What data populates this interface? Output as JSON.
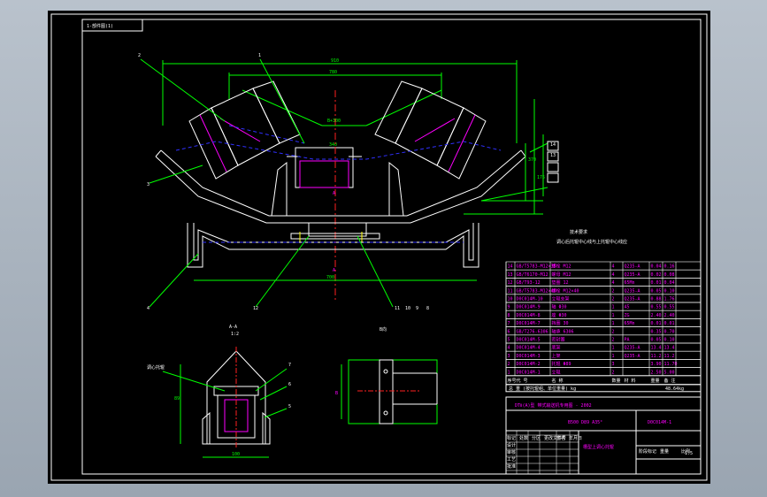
{
  "drawing": {
    "stamp": "1-部件图(1)",
    "title_main": "DTⅡ(A)型  带式输送机专用图 - 2002",
    "title_code": "B500 D89 A35°",
    "title_drawing_no": "D0C014M-1",
    "title_name": "槽型上调心托辊",
    "section_label_a": "A-A",
    "section_label_a_scale": "1:2",
    "section_label_b": "B向",
    "notes_heading": "技术要求",
    "notes_text": "调心后托辊中心线与上托辊中心线应",
    "total_weight": "48.64kg",
    "dim_top_overall": "910",
    "dim_inner": "780",
    "dim_mid": "B+300",
    "dim_center": "340",
    "dim_base": "1000",
    "dim_base_inner": "700",
    "dim_height_a": "370",
    "dim_height_b": "175",
    "dim_side": "25",
    "dim_label_a": "A",
    "dim_label_b": "B",
    "dim_detail_w": "100",
    "dim_detail_h": "89",
    "part_label": "调心托辊"
  },
  "balloons": [
    "2",
    "1",
    "3",
    "4",
    "12",
    "11",
    "10",
    "9",
    "8",
    "14",
    "13",
    "7",
    "6",
    "5"
  ],
  "parts_table": {
    "rows": [
      {
        "no": "14",
        "code": "GB/T5783-M12×35",
        "name": "螺栓 M12",
        "qty": "4",
        "mat": "Q235-A",
        "wt": "0.04",
        "total": "0.16"
      },
      {
        "no": "13",
        "code": "GB/T6170-M12",
        "name": "螺母 M12",
        "qty": "4",
        "mat": "Q235-A",
        "wt": "0.02",
        "total": "0.08"
      },
      {
        "no": "12",
        "code": "GB/T93-12",
        "name": "垫圈 12",
        "qty": "4",
        "mat": "65Mn",
        "wt": "0.01",
        "total": "0.04"
      },
      {
        "no": "11",
        "code": "GB/T5783-M12×40",
        "name": "螺栓 M12×40",
        "qty": "2",
        "mat": "Q235-A",
        "wt": "0.05",
        "total": "0.10"
      },
      {
        "no": "10",
        "code": "D0C014M-10",
        "name": "立辊支架",
        "qty": "2",
        "mat": "Q235-A",
        "wt": "0.88",
        "total": "1.76"
      },
      {
        "no": "9",
        "code": "D0C014M-9",
        "name": "轴 Φ30",
        "qty": "1",
        "mat": "45",
        "wt": "0.55",
        "total": "0.55"
      },
      {
        "no": "8",
        "code": "D0C014M-8",
        "name": "座 Φ30",
        "qty": "1",
        "mat": "ZG",
        "wt": "2.40",
        "total": "2.40"
      },
      {
        "no": "7",
        "code": "D0C014M-7",
        "name": "挡圈 30",
        "qty": "1",
        "mat": "65Mn",
        "wt": "0.01",
        "total": "0.01"
      },
      {
        "no": "6",
        "code": "GB/T276-6306",
        "name": "轴承 6306",
        "qty": "2",
        "mat": "",
        "wt": "0.35",
        "total": "0.70"
      },
      {
        "no": "5",
        "code": "D0C014M-5",
        "name": "密封圈",
        "qty": "2",
        "mat": "PA",
        "wt": "0.05",
        "total": "0.10"
      },
      {
        "no": "4",
        "code": "D0C014M-4",
        "name": "底架",
        "qty": "1",
        "mat": "Q235-A",
        "wt": "13.4",
        "total": "13.4"
      },
      {
        "no": "3",
        "code": "D0C014M-3",
        "name": "上架",
        "qty": "1",
        "mat": "Q235-A",
        "wt": "11.2",
        "total": "11.2"
      },
      {
        "no": "2",
        "code": "D0C014M-2",
        "name": "托辊 Φ89",
        "qty": "3",
        "mat": "",
        "wt": "3.90",
        "total": "11.70"
      },
      {
        "no": "1",
        "code": "D0C014M-1",
        "name": "立辊",
        "qty": "2",
        "mat": "",
        "wt": "2.50",
        "total": "5.00"
      }
    ],
    "header": {
      "no": "序号",
      "code": "代 号",
      "name": "名 称",
      "qty": "数量",
      "mat": "材 料",
      "weight": "重量",
      "note": "备 注"
    },
    "subheader": "总 重  (按托辊组、单位重量)  kg",
    "signoff": [
      "标记",
      "处数",
      "分区",
      "更改文件号",
      "签名",
      "年月日",
      "设计",
      "审核",
      "工艺",
      "批准",
      "阶段标记",
      "重量",
      "比例"
    ],
    "scale": "1:5"
  }
}
